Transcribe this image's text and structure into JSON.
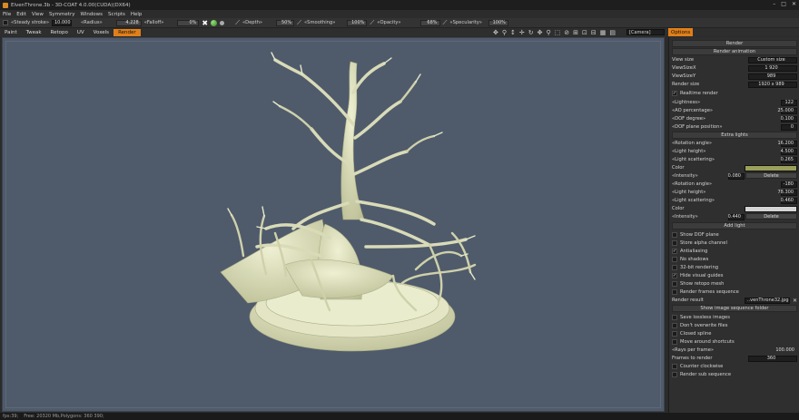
{
  "window": {
    "title": "ElvenThrone.3b - 3D-COAT 4.0.00(CUDA)(DX64)"
  },
  "menu": [
    "File",
    "Edit",
    "View",
    "Symmetry",
    "Windows",
    "Scripts",
    "Help"
  ],
  "toolbar": {
    "stroke_label": "«Steady stroke»",
    "stroke_value": "10.000",
    "radius_label": "«Radius»",
    "radius_value": "4.228",
    "falloff_label": "«Falloff»",
    "falloff_value": "0%",
    "depth_label": "«Depth»",
    "depth_value": "50%",
    "smoothing_label": "«Smoothing»",
    "smoothing_value": "100%",
    "opacity_label": "«Opacity»",
    "opacity_value": "68%",
    "specularity_label": "«Specularity»",
    "specularity_value": "100%"
  },
  "tabs": [
    {
      "label": "Paint",
      "active": false
    },
    {
      "label": "Tweak",
      "active": false
    },
    {
      "label": "Retopo",
      "active": false
    },
    {
      "label": "UV",
      "active": false
    },
    {
      "label": "Voxels",
      "active": false
    },
    {
      "label": "Render",
      "active": true
    }
  ],
  "camera": "[Camera]",
  "options_tab": "Options",
  "render": {
    "header": "Render",
    "render_animation": "Render animation",
    "view_size_label": "View size",
    "view_size_value": "Custom size",
    "view_size_x_label": "ViewSizeX",
    "view_size_x_value": "1 920",
    "view_size_y_label": "ViewSizeY",
    "view_size_y_value": "989",
    "render_size_label": "Render size",
    "render_size_value": "1920 x 989",
    "realtime_render": "Realtime render",
    "lightness_label": "«Lightness»",
    "lightness_value": "122",
    "ao_label": "«AO percentage»",
    "ao_value": "25.000",
    "dof_degree_label": "«DOF degree»",
    "dof_degree_value": "0.100",
    "dof_plane_label": "«DOF plane position»",
    "dof_plane_value": "0",
    "extra_lights": "Extra lights",
    "light1": {
      "rotation_label": "«Rotation angle»",
      "rotation_value": "16.200",
      "height_label": "«Light height»",
      "height_value": "4.500",
      "scattering_label": "«Light scattering»",
      "scattering_value": "0.265",
      "color_label": "Color",
      "color": "#9aa05a",
      "intensity_label": "«Intensity»",
      "intensity_value": "0.080",
      "delete": "Delete"
    },
    "light2": {
      "rotation_label": "«Rotation angle»",
      "rotation_value": "-180",
      "height_label": "«Light height»",
      "height_value": "78.300",
      "scattering_label": "«Light scattering»",
      "scattering_value": "0.460",
      "color_label": "Color",
      "color": "#d4d4d4",
      "intensity_label": "«Intensity»",
      "intensity_value": "0.440",
      "delete": "Delete"
    },
    "add_light": "Add light",
    "checks": [
      {
        "label": "Show DOF plane",
        "checked": false
      },
      {
        "label": "Store alpha channel",
        "checked": false
      },
      {
        "label": "Antialiasing",
        "checked": true
      },
      {
        "label": "No shadows",
        "checked": false
      },
      {
        "label": "32-bit rendering",
        "checked": false
      },
      {
        "label": "Hide visual guides",
        "checked": true
      },
      {
        "label": "Show retopo mesh",
        "checked": false
      },
      {
        "label": "Render frames sequence",
        "checked": false
      }
    ],
    "render_result_label": "Render result",
    "render_result_value": "..venThrone32.jpg",
    "show_folder": "Show image sequence folder",
    "checks2": [
      {
        "label": "Save lossless images",
        "checked": false
      },
      {
        "label": "Don't overwrite files",
        "checked": false
      },
      {
        "label": "Closed spline",
        "checked": false
      },
      {
        "label": "Move around shortcuts",
        "checked": false
      }
    ],
    "rays_label": "«Rays per frame»",
    "rays_value": "100.000",
    "frames_label": "Frames to render",
    "frames_value": "360",
    "checks3": [
      {
        "label": "Counter clockwise",
        "checked": false
      },
      {
        "label": "Render sub sequence",
        "checked": false
      }
    ]
  },
  "status": {
    "fps": "fps:39;",
    "memory": "Free: 20320 Mb,Polygons: 360 390;"
  },
  "colors": {
    "accent": "#e07f1a",
    "viewport": "#4f5b6b",
    "model": "#d9dbb8"
  }
}
